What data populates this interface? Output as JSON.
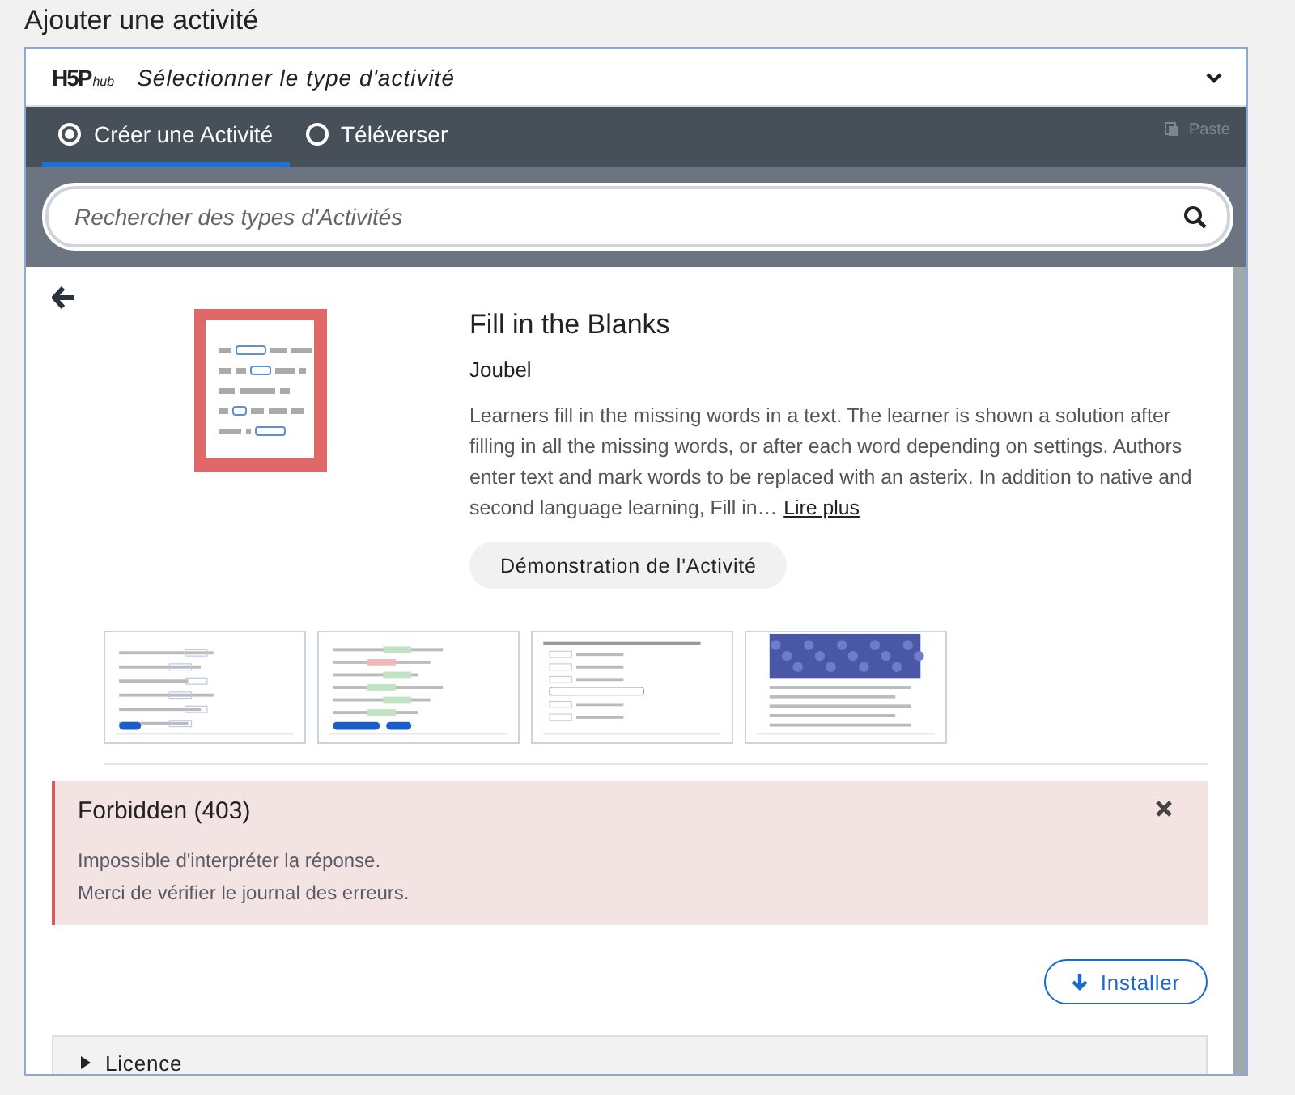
{
  "page_title": "Ajouter une activité",
  "hub": {
    "logo": "H5P",
    "logo_sub": "hub",
    "title": "Sélectionner le type d'activité",
    "expanded": true
  },
  "tabs": [
    {
      "label": "Créer une Activité",
      "selected": true
    },
    {
      "label": "Téléverser",
      "selected": false
    }
  ],
  "paste": {
    "label": "Paste",
    "disabled": true
  },
  "search": {
    "placeholder": "Rechercher des types d'Activités"
  },
  "detail": {
    "title": "Fill in the Blanks",
    "author": "Joubel",
    "description": "Learners fill in the missing words in a text. The learner is shown a solution after filling in all the missing words, or after each word depending on settings. Authors enter text and mark words to be replaced with an asterix. In addition to native and second language learning, Fill in…",
    "read_more": "Lire plus",
    "demo_button": "Démonstration de l'Activité",
    "screenshots": [
      {
        "kind": "text"
      },
      {
        "kind": "feedback"
      },
      {
        "kind": "dropdown"
      },
      {
        "kind": "photo"
      }
    ]
  },
  "error": {
    "title": "Forbidden (403)",
    "lines": [
      "Impossible d'interpréter la réponse.",
      "Merci de vérifier le journal des erreurs."
    ]
  },
  "install_button": "Installer",
  "licence": {
    "label": "Licence",
    "expanded": false
  }
}
